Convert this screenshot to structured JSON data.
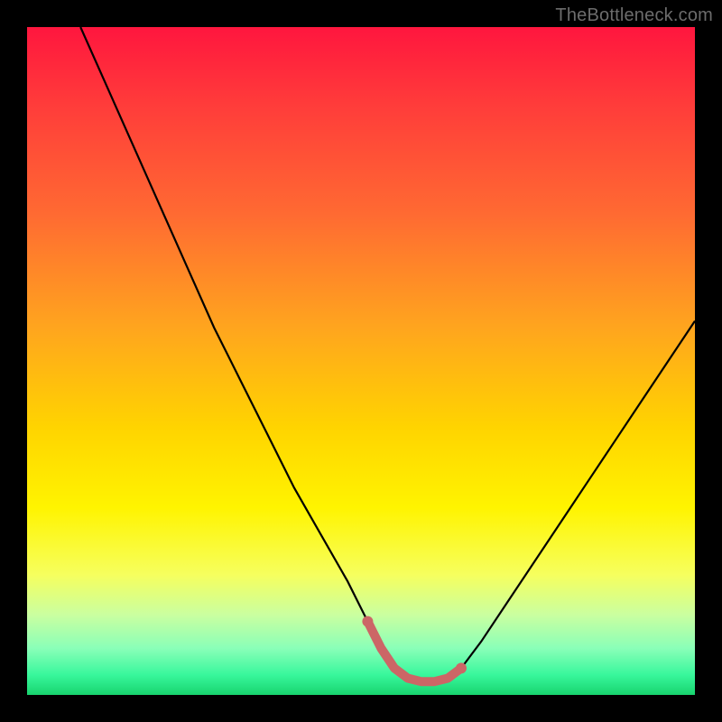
{
  "watermark": "TheBottleneck.com",
  "colors": {
    "bg": "#000000",
    "curve": "#000000",
    "marker": "#cc6666",
    "gradient_top": "#ff163e",
    "gradient_bottom": "#18d46e"
  },
  "chart_data": {
    "type": "line",
    "title": "",
    "xlabel": "",
    "ylabel": "",
    "xlim": [
      0,
      100
    ],
    "ylim": [
      0,
      100
    ],
    "grid": false,
    "legend": false,
    "annotations": [],
    "series": [
      {
        "name": "bottleneck-curve",
        "x": [
          8,
          12,
          16,
          20,
          24,
          28,
          32,
          36,
          40,
          44,
          48,
          51,
          53,
          55,
          57,
          59,
          61,
          63,
          65,
          68,
          72,
          76,
          80,
          84,
          88,
          92,
          96,
          100
        ],
        "values": [
          100,
          91,
          82,
          73,
          64,
          55,
          47,
          39,
          31,
          24,
          17,
          11,
          7,
          4,
          2.5,
          2,
          2,
          2.5,
          4,
          8,
          14,
          20,
          26,
          32,
          38,
          44,
          50,
          56
        ]
      }
    ],
    "markers": {
      "name": "bottleneck-minimum",
      "color": "#cc6666",
      "x": [
        51,
        53,
        55,
        57,
        59,
        61,
        63,
        65
      ],
      "values": [
        11,
        7,
        4,
        2.5,
        2,
        2,
        2.5,
        4
      ]
    }
  }
}
